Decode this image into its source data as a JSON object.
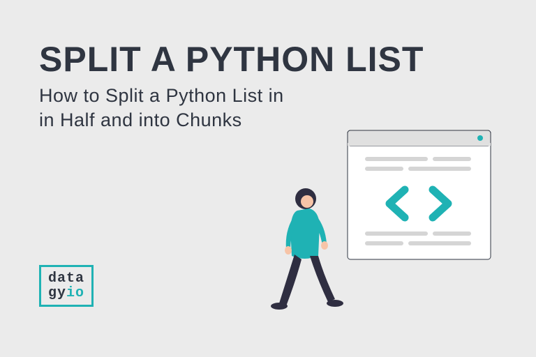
{
  "title": "SPLIT A PYTHON LIST",
  "subtitle_line1": "How to Split a Python List in",
  "subtitle_line2": "in Half and into Chunks",
  "logo": {
    "line1": "data",
    "line2_a": "gy",
    "line2_b": "io"
  },
  "colors": {
    "accent": "#1fb2b4",
    "dark": "#2f3541",
    "bg": "#ebebeb"
  }
}
